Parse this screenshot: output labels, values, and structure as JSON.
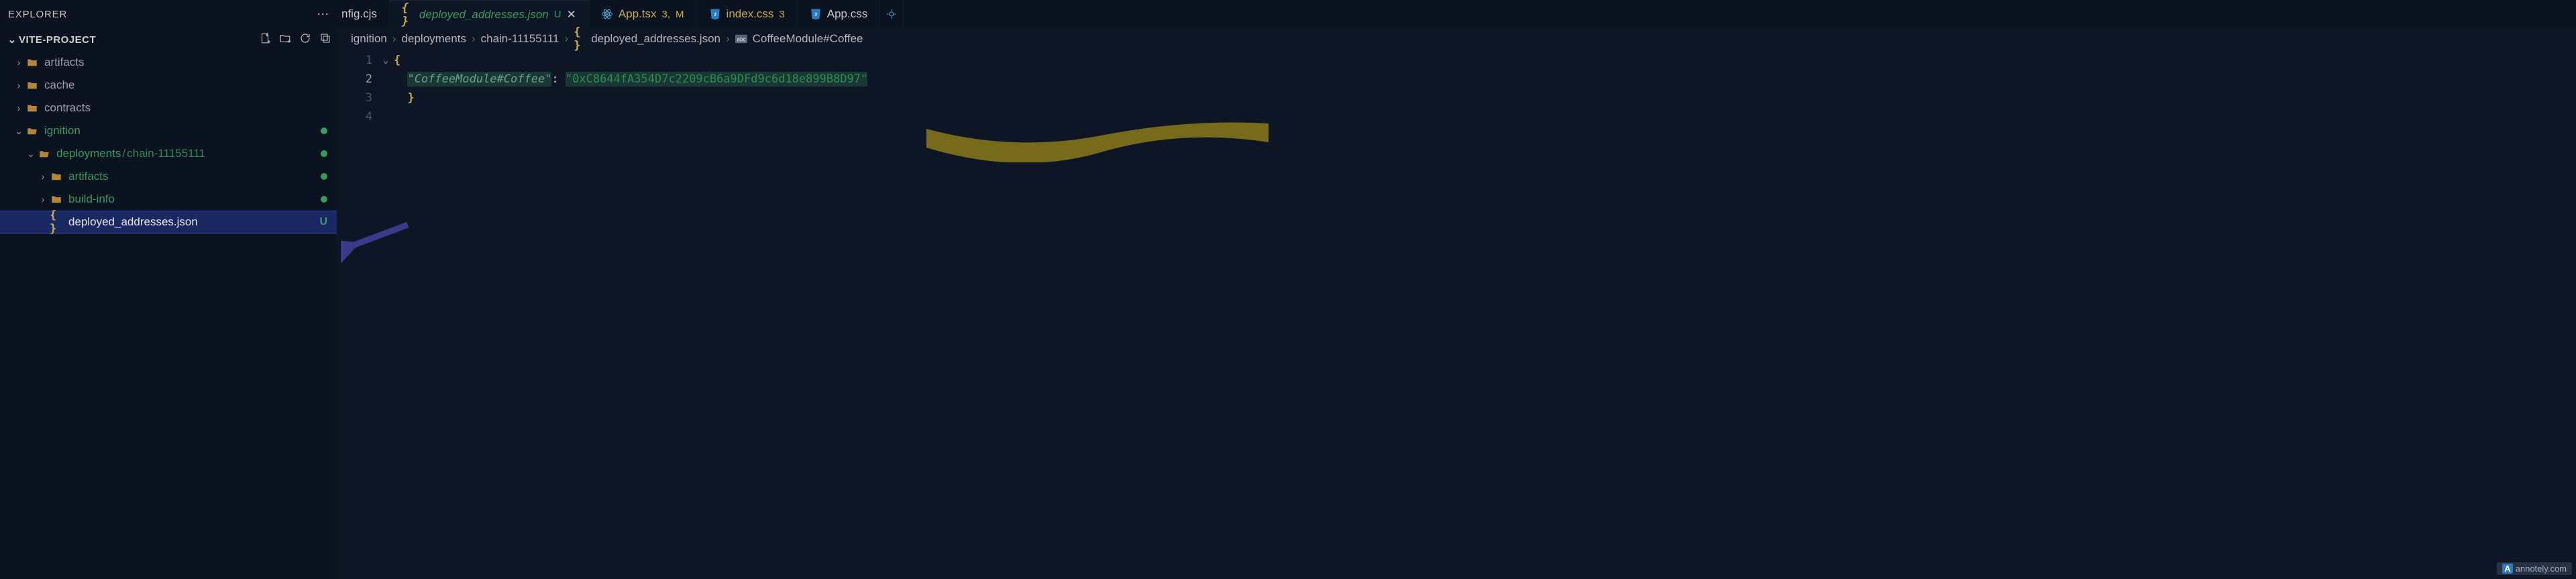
{
  "explorer": {
    "title": "EXPLORER",
    "project": "VITE-PROJECT",
    "items": [
      {
        "label": "artifacts",
        "type": "folder",
        "open": false,
        "depth": 1
      },
      {
        "label": "cache",
        "type": "folder",
        "open": false,
        "depth": 1
      },
      {
        "label": "contracts",
        "type": "folder",
        "open": false,
        "depth": 1
      },
      {
        "label": "ignition",
        "type": "folder",
        "open": true,
        "depth": 1,
        "green": true,
        "dot": true
      },
      {
        "label": "deployments",
        "sublabel": "chain-11155111",
        "type": "folder",
        "open": true,
        "depth": 2,
        "green": true,
        "dot": true
      },
      {
        "label": "artifacts",
        "type": "folder",
        "open": false,
        "depth": 3,
        "green": true,
        "dot": true
      },
      {
        "label": "build-info",
        "type": "folder",
        "open": false,
        "depth": 3,
        "green": true,
        "dot": true
      },
      {
        "label": "deployed_addresses.json",
        "type": "file-json",
        "depth": 3,
        "selected": true,
        "badge": "U"
      }
    ]
  },
  "tabs": [
    {
      "label": "nfig.cjs",
      "partial": true
    },
    {
      "label": "deployed_addresses.json",
      "icon": "braces",
      "active": true,
      "badge_u": "U",
      "close": true
    },
    {
      "label": "App.tsx",
      "icon": "react",
      "badge_num": "3,",
      "badge_m": "M"
    },
    {
      "label": "index.css",
      "icon": "css",
      "badge_num": "3"
    },
    {
      "label": "App.css",
      "icon": "css"
    }
  ],
  "breadcrumb": [
    {
      "label": "ignition"
    },
    {
      "label": "deployments"
    },
    {
      "label": "chain-11155111"
    },
    {
      "label": "deployed_addresses.json",
      "icon": "braces"
    },
    {
      "label": "CoffeeModule#Coffee",
      "icon": "abc"
    }
  ],
  "code": {
    "line_numbers": [
      "1",
      "2",
      "3",
      "4"
    ],
    "l1_open": "{",
    "l2_key": "\"CoffeeModule#Coffee\"",
    "l2_colon": ":",
    "l2_val": "\"0xC8644fA354D7c2209cB6a9DFd9c6d18e899B8D97\"",
    "l3_close": "}"
  },
  "watermark": "annotely.com"
}
